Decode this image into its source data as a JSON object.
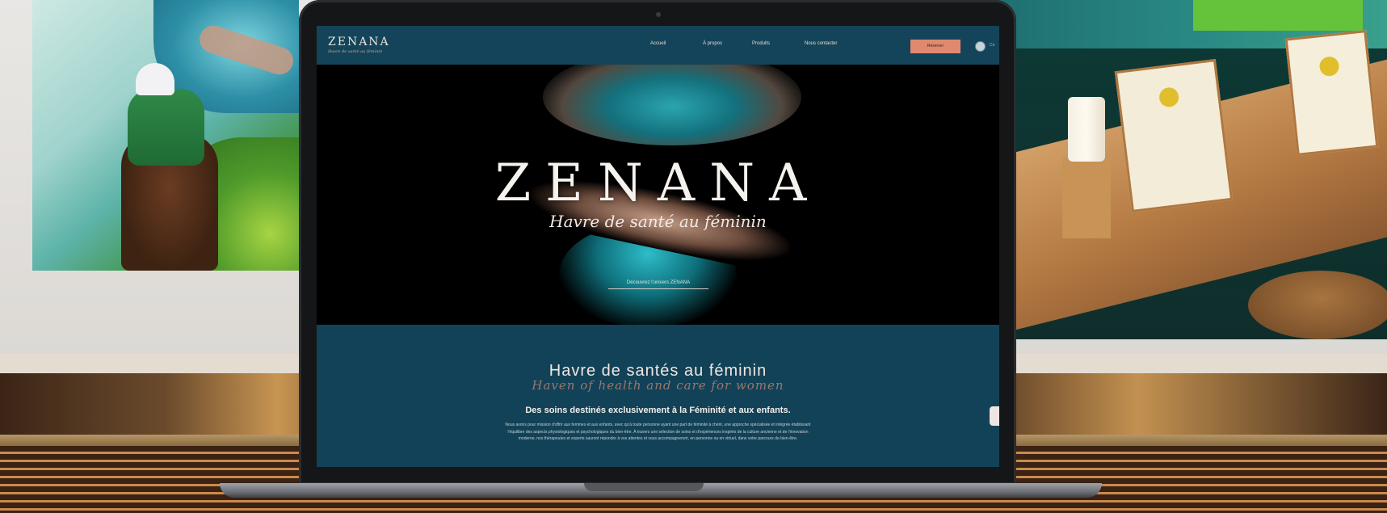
{
  "site": {
    "logo": "ZENANA",
    "tagline": "Havre de santé au féminin",
    "nav": [
      "Accueil",
      "À propos",
      "Produits",
      "Nous contacter"
    ],
    "cta_label": "Réserver",
    "login_label": "Co"
  },
  "hero": {
    "title": "ZENANA",
    "subtitle": "Havre de santé au féminin",
    "link_label": "Découvrez l'univers ZENANA"
  },
  "section": {
    "title": "Havre de santés au féminin",
    "script_title": "Haven of health and care for women",
    "heading": "Des soins destinés exclusivement à la Féminité et aux enfants.",
    "body": "Nous avons pour mission d'offrir aux femmes et aux enfants, avec qu'à toute personne ayant une part de féminité à chérir, une approche spécialisée et intégrée établissant l'équilibre des aspects physiologiques et psychologiques du bien-être. À travers une sélection de soins et d'expériences inspirés de la culture ancienne et de l'innovation moderne, nos thérapeutes et experts sauront répondre à vos attentes et vous accompagneront, en personne ou en virtuel, dans votre parcours de bien-être."
  },
  "colors": {
    "header": "#144459",
    "section": "#124257",
    "accent": "#df8a70"
  }
}
